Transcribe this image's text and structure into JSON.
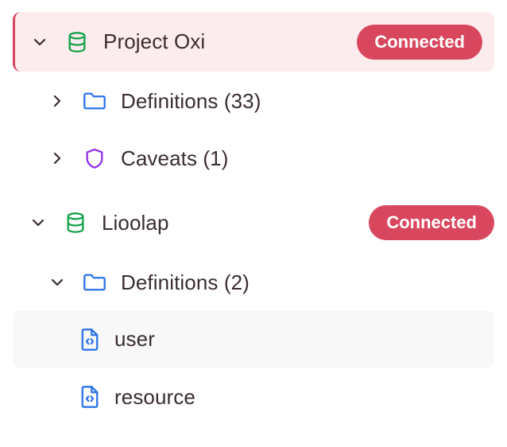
{
  "colors": {
    "accent": "#d9475f",
    "selected_bg": "#fdeced",
    "hover_bg": "#f8f8f8",
    "database_icon": "#16a34a",
    "folder_icon": "#2b73e8",
    "shield_icon": "#9333ea",
    "file_icon": "#2b73e8",
    "text": "#3a2c30"
  },
  "tree": {
    "project_oxi": {
      "label": "Project Oxi",
      "icon": "database-icon",
      "expanded": true,
      "status": "Connected",
      "definitions": {
        "label": "Definitions (33)",
        "icon": "folder-icon",
        "expanded": false
      },
      "caveats": {
        "label": "Caveats (1)",
        "icon": "shield-icon",
        "expanded": false
      }
    },
    "lioolap": {
      "label": "Lioolap",
      "icon": "database-icon",
      "expanded": true,
      "status": "Connected",
      "definitions": {
        "label": "Definitions (2)",
        "icon": "folder-icon",
        "expanded": true,
        "items": [
          {
            "label": "user",
            "icon": "file-code-icon"
          },
          {
            "label": "resource",
            "icon": "file-code-icon"
          }
        ]
      }
    }
  }
}
